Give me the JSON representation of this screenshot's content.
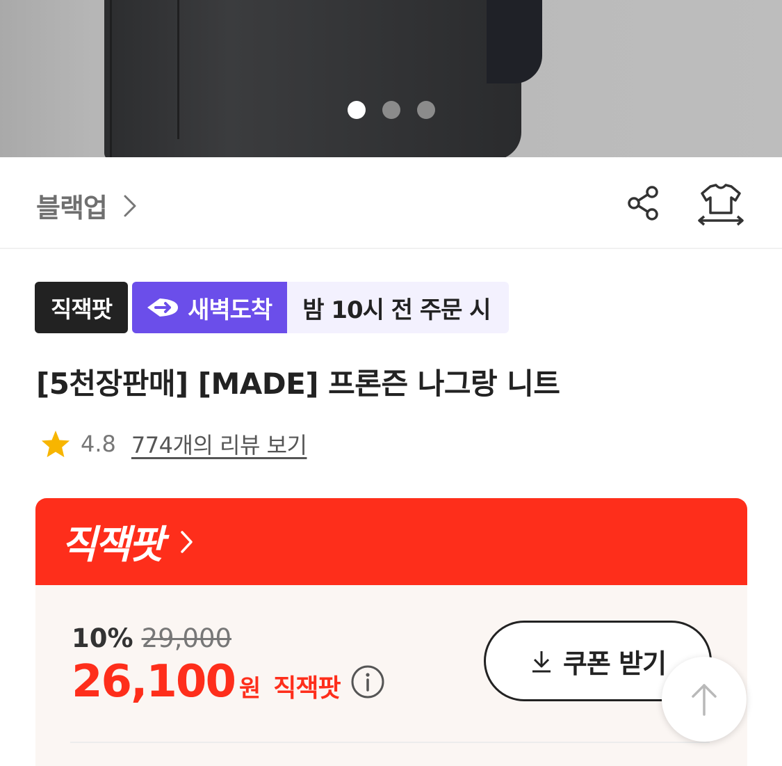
{
  "hero": {
    "image_alt": "product-photo",
    "dots": [
      true,
      false,
      false
    ]
  },
  "brand": {
    "name": "블랙업",
    "chevron": "›"
  },
  "badges": {
    "brand_badge": "직잭팟",
    "delivery_badge": "새벽도착",
    "delivery_note": "밤 10시 전 주문 시"
  },
  "product": {
    "title": "[5천장판매] [MADE] 프론즌 나그랑 니트"
  },
  "rating": {
    "value": "4.8",
    "review_link": "774개의 리뷰 보기"
  },
  "deal": {
    "logo": "직잭팟",
    "discount": "10%",
    "original_price": "29,000",
    "final_price": "26,100",
    "currency": "원",
    "final_label": "직잭팟",
    "coupon_label": "쿠폰 받기"
  },
  "icons": {
    "share": "share-icon",
    "fit": "size-fit-icon",
    "star": "star-icon",
    "dawn": "dawn-delivery-icon",
    "info": "info-icon",
    "download": "download-icon",
    "scroll_top": "arrow-up-icon"
  },
  "colors": {
    "deal_red": "#fe2e1b",
    "dawn_purple": "#6b4eea",
    "star_yellow": "#f7b500"
  }
}
